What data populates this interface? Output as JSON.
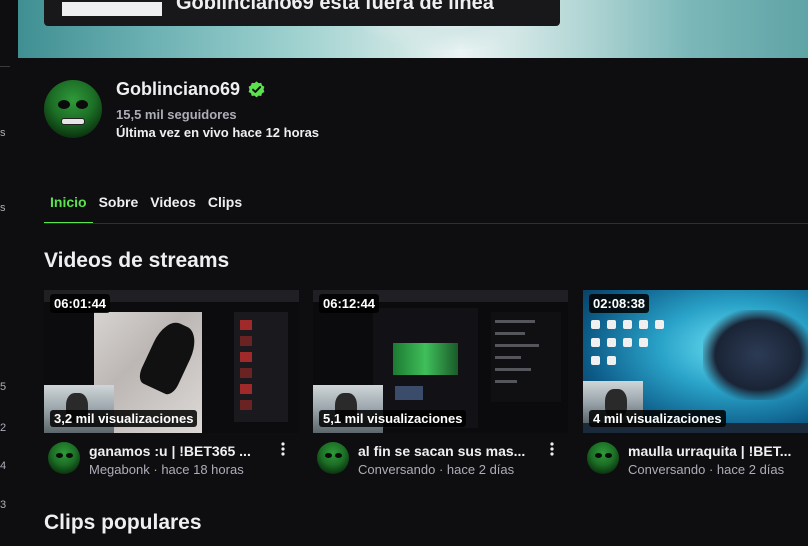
{
  "banner": {
    "offline_text": "Goblinciano69 está fuera de línea"
  },
  "channel": {
    "name": "Goblinciano69",
    "followers": "15,5 mil seguidores",
    "last_live": "Última vez en vivo hace 12 horas",
    "verified": true
  },
  "tabs": [
    {
      "label": "Inicio",
      "active": true
    },
    {
      "label": "Sobre",
      "active": false
    },
    {
      "label": "Videos",
      "active": false
    },
    {
      "label": "Clips",
      "active": false
    }
  ],
  "sections": {
    "videos_title": "Videos de streams",
    "clips_title": "Clips populares"
  },
  "videos": [
    {
      "duration": "06:01:44",
      "views": "3,2 mil visualizaciones",
      "title": "ganamos :u | !BET365 ...",
      "category": "Megabonk",
      "age": "hace 18 horas"
    },
    {
      "duration": "06:12:44",
      "views": "5,1 mil visualizaciones",
      "title": "al fin se sacan sus mas...",
      "category": "Conversando",
      "age": "hace 2 días"
    },
    {
      "duration": "02:08:38",
      "views": "4 mil visualizaciones",
      "title": "maulla urraquita | !BET...",
      "category": "Conversando",
      "age": "hace 2 días"
    }
  ],
  "colors": {
    "background": "#0e0e10",
    "accent_green": "#5ce14f",
    "muted_text": "#adadb8"
  },
  "icons": {
    "verified": "verified-check-icon",
    "more": "kebab-menu-icon"
  },
  "separator": "·"
}
